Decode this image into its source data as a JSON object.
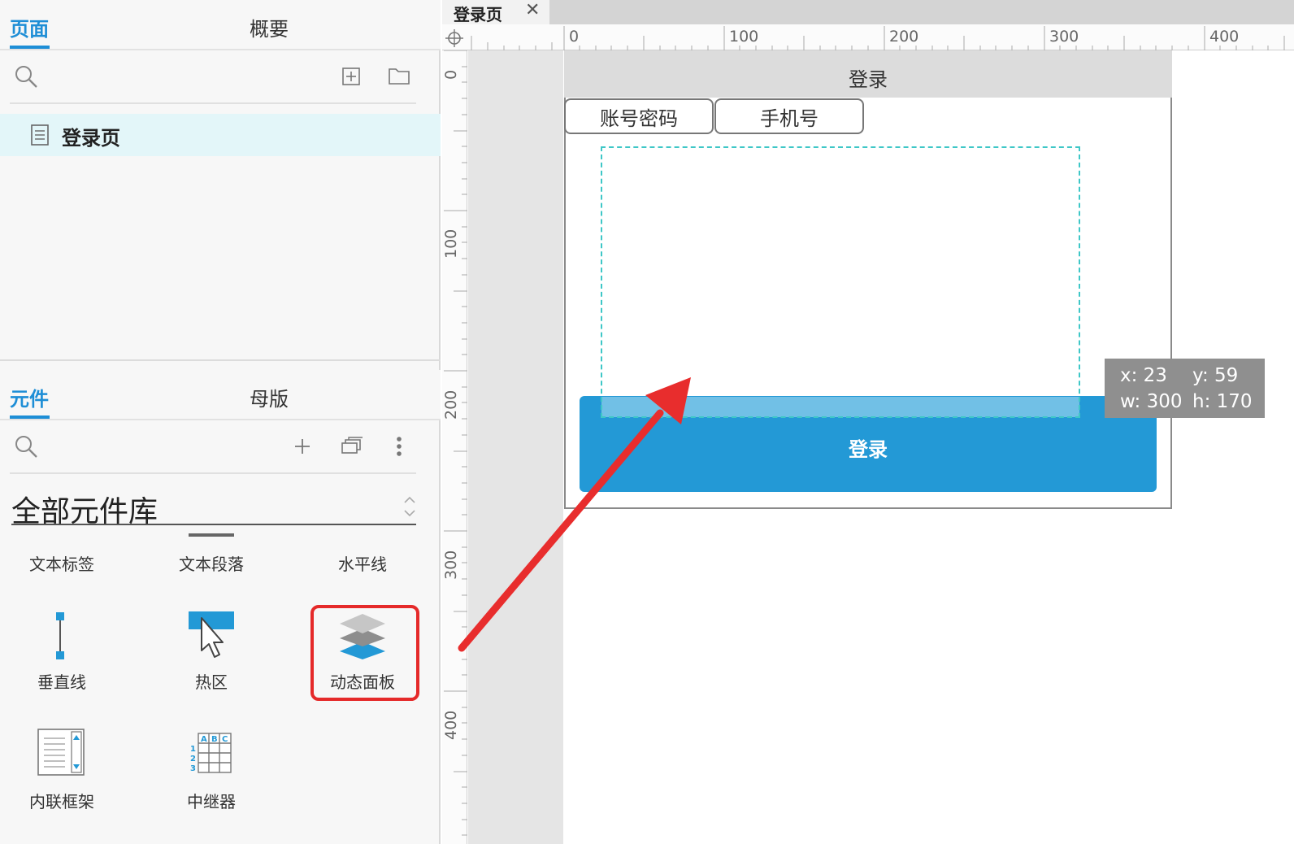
{
  "left_panel": {
    "top_tabs": {
      "pages": "页面",
      "outline": "概要"
    },
    "pages": [
      {
        "label": "登录页"
      }
    ],
    "bottom_tabs": {
      "widgets": "元件",
      "masters": "母版"
    },
    "library_name": "全部元件库",
    "widgets": [
      {
        "label": "文本标签"
      },
      {
        "label": "文本段落"
      },
      {
        "label": "水平线"
      },
      {
        "label": "垂直线"
      },
      {
        "label": "热区"
      },
      {
        "label": "动态面板"
      },
      {
        "label": "内联框架"
      },
      {
        "label": "中继器"
      }
    ]
  },
  "editor": {
    "tab_title": "登录页",
    "close_glyph": "✕",
    "ruler_h": [
      "0",
      "100",
      "200",
      "300",
      "400"
    ],
    "ruler_v": [
      "0",
      "100",
      "200",
      "300",
      "400"
    ]
  },
  "canvas": {
    "header_title": "登录",
    "tabs": [
      "账号密码",
      "手机号"
    ],
    "login_button": "登录",
    "selection": {
      "x_label": "x: 23",
      "y_label": "y: 59",
      "w_label": "w: 300",
      "h_label": "h: 170"
    }
  },
  "colors": {
    "accent": "#1e8ed6",
    "highlight": "#e53935",
    "button": "#2399d6"
  }
}
